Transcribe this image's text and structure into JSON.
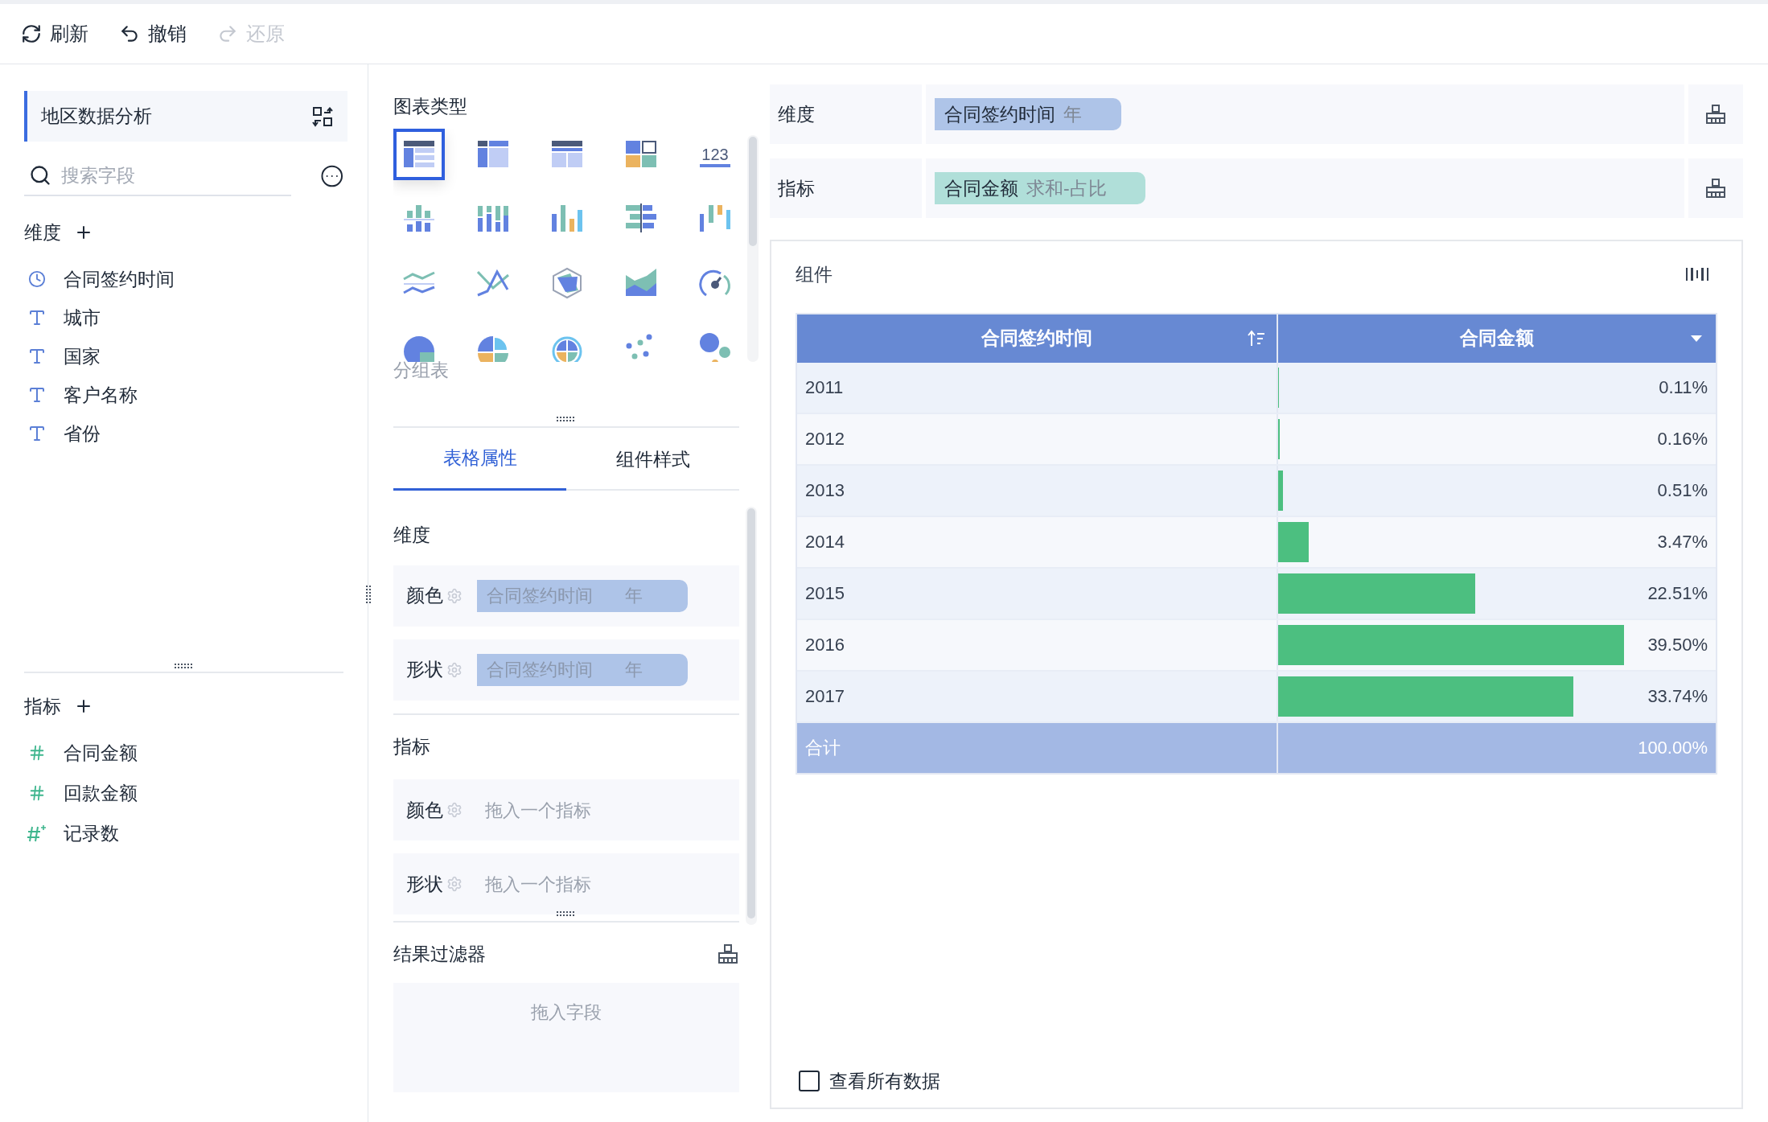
{
  "toolbar": [
    {
      "label": "刷新",
      "disabled": false
    },
    {
      "label": "撤销",
      "disabled": false
    },
    {
      "label": "还原",
      "disabled": true
    }
  ],
  "field_panel": {
    "title": "地区数据分析",
    "search": {
      "placeholder": "搜索字段"
    },
    "dimensions": {
      "title": "维度",
      "fields": [
        {
          "name": "合同签约时间",
          "kind": "time"
        },
        {
          "name": "城市",
          "kind": "text"
        },
        {
          "name": "国家",
          "kind": "text"
        },
        {
          "name": "客户名称",
          "kind": "text"
        },
        {
          "name": "省份",
          "kind": "text"
        }
      ]
    },
    "measures": {
      "title": "指标",
      "fields": [
        {
          "name": "合同金额",
          "kind": "number"
        },
        {
          "name": "回款金额",
          "kind": "number"
        },
        {
          "name": "记录数",
          "kind": "count"
        }
      ]
    }
  },
  "config_panel": {
    "chart_types_title": "图表类型",
    "chart_types": [
      {
        "kind": "group-table",
        "selected": true
      },
      {
        "kind": "cross-table",
        "selected": false
      },
      {
        "kind": "detail-table",
        "selected": false
      },
      {
        "kind": "tiles",
        "selected": false
      },
      {
        "kind": "kpi",
        "glyph": "123",
        "selected": false
      },
      {
        "kind": "diverging-bars",
        "selected": false
      },
      {
        "kind": "stacked-columns",
        "selected": false
      },
      {
        "kind": "columns",
        "selected": false
      },
      {
        "kind": "mirror-bars",
        "selected": false
      },
      {
        "kind": "waterfall",
        "selected": false
      },
      {
        "kind": "waves",
        "selected": false
      },
      {
        "kind": "lines",
        "selected": false
      },
      {
        "kind": "radar",
        "selected": false
      },
      {
        "kind": "area",
        "selected": false
      },
      {
        "kind": "gauge",
        "selected": false
      },
      {
        "kind": "pie",
        "selected": false
      },
      {
        "kind": "quarters",
        "selected": false
      },
      {
        "kind": "rings",
        "selected": false
      },
      {
        "kind": "scatter",
        "selected": false
      },
      {
        "kind": "bubbles",
        "selected": false
      }
    ],
    "chart_type_caption": "分组表",
    "tabs": [
      {
        "label": "表格属性",
        "selected": true
      },
      {
        "label": "组件样式",
        "selected": false
      }
    ],
    "dimension_section": {
      "title": "维度",
      "slots": [
        {
          "label": "颜色",
          "field": "合同签约时间",
          "unit": "年"
        },
        {
          "label": "形状",
          "field": "合同签约时间",
          "unit": "年"
        }
      ]
    },
    "measure_section": {
      "title": "指标",
      "slots": [
        {
          "label": "颜色",
          "hint": "拖入一个指标"
        },
        {
          "label": "形状",
          "hint": "拖入一个指标"
        }
      ]
    },
    "result_filter": {
      "title": "结果过滤器",
      "hint": "拖入字段"
    }
  },
  "shelves": [
    {
      "label": "维度",
      "field": "合同签约时间",
      "detail": "年",
      "kind": "dimension"
    },
    {
      "label": "指标",
      "field": "合同金额",
      "detail": "求和-占比",
      "kind": "measure"
    }
  ],
  "component": {
    "title": "组件",
    "table": {
      "columns": [
        "合同签约时间",
        "合同金额"
      ],
      "rows": [
        {
          "year": "2011",
          "value": "0.11%",
          "level": 0.0022
        },
        {
          "year": "2012",
          "value": "0.16%",
          "level": 0.0032
        },
        {
          "year": "2013",
          "value": "0.51%",
          "level": 0.0102
        },
        {
          "year": "2014",
          "value": "3.47%",
          "level": 0.0694
        },
        {
          "year": "2015",
          "value": "22.51%",
          "level": 0.4502
        },
        {
          "year": "2016",
          "value": "39.50%",
          "level": 0.79
        },
        {
          "year": "2017",
          "value": "33.74%",
          "level": 0.6748
        }
      ],
      "total": {
        "label": "合计",
        "value": "100.00%"
      }
    },
    "view_all": {
      "label": "查看所有数据",
      "checked": false
    }
  }
}
